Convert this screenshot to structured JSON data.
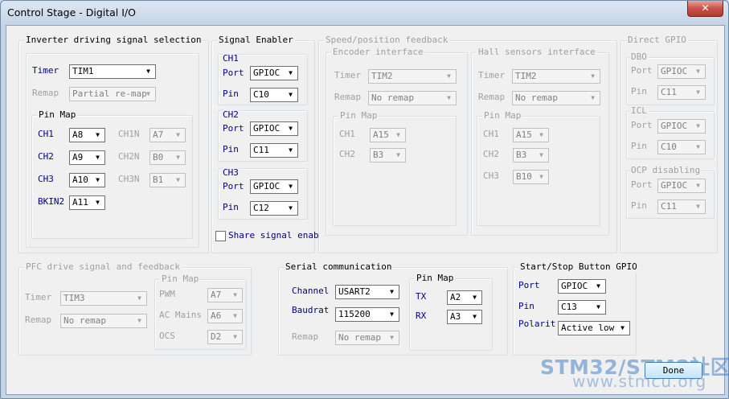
{
  "window": {
    "title": "Control Stage - Digital I/O",
    "close_glyph": "✕"
  },
  "inverter": {
    "legend": "Inverter driving signal selection",
    "timer_label": "Timer",
    "timer_value": "TIM1",
    "remap_label": "Remap",
    "remap_value": "Partial re-map",
    "pinmap": {
      "legend": "Pin Map",
      "ch1_label": "CH1",
      "ch1_value": "A8",
      "ch1n_label": "CH1N",
      "ch1n_value": "A7",
      "ch2_label": "CH2",
      "ch2_value": "A9",
      "ch2n_label": "CH2N",
      "ch2n_value": "B0",
      "ch3_label": "CH3",
      "ch3_value": "A10",
      "ch3n_label": "CH3N",
      "ch3n_value": "B1",
      "bkin2_label": "BKIN2",
      "bkin2_value": "A11"
    }
  },
  "signal_enabler": {
    "legend": "Signal Enabler",
    "ch1": {
      "legend": "CH1",
      "port_label": "Port",
      "port_value": "GPIOC",
      "pin_label": "Pin",
      "pin_value": "C10"
    },
    "ch2": {
      "legend": "CH2",
      "port_label": "Port",
      "port_value": "GPIOC",
      "pin_label": "Pin",
      "pin_value": "C11"
    },
    "ch3": {
      "legend": "CH3",
      "port_label": "Port",
      "port_value": "GPIOC",
      "pin_label": "Pin",
      "pin_value": "C12"
    },
    "share_label": "Share signal enab"
  },
  "speed_feedback": {
    "legend": "Speed/position feedback",
    "encoder": {
      "legend": "Encoder interface",
      "timer_label": "Timer",
      "timer_value": "TIM2",
      "remap_label": "Remap",
      "remap_value": "No remap",
      "pinmap_legend": "Pin Map",
      "ch1_label": "CH1",
      "ch1_value": "A15",
      "ch2_label": "CH2",
      "ch2_value": "B3"
    },
    "hall": {
      "legend": "Hall sensors interface",
      "timer_label": "Timer",
      "timer_value": "TIM2",
      "remap_label": "Remap",
      "remap_value": "No remap",
      "pinmap_legend": "Pin Map",
      "ch1_label": "CH1",
      "ch1_value": "A15",
      "ch2_label": "CH2",
      "ch2_value": "B3",
      "ch3_label": "CH3",
      "ch3_value": "B10"
    }
  },
  "direct_gpio": {
    "legend": "Direct GPIO",
    "dbo": {
      "legend": "DBO",
      "port_label": "Port",
      "port_value": "GPIOC",
      "pin_label": "Pin",
      "pin_value": "C11"
    },
    "icl": {
      "legend": "ICL",
      "port_label": "Port",
      "port_value": "GPIOC",
      "pin_label": "Pin",
      "pin_value": "C10"
    },
    "ocp": {
      "legend": "OCP disabling",
      "port_label": "Port",
      "port_value": "GPIOC",
      "pin_label": "Pin",
      "pin_value": "C11"
    }
  },
  "pfc": {
    "legend": "PFC drive signal and feedback",
    "timer_label": "Timer",
    "timer_value": "TIM3",
    "remap_label": "Remap",
    "remap_value": "No remap",
    "pinmap": {
      "legend": "Pin Map",
      "pwm_label": "PWM",
      "pwm_value": "A7",
      "acmains_label": "AC Mains",
      "acmains_value": "A6",
      "ocs_label": "OCS",
      "ocs_value": "D2"
    }
  },
  "serial": {
    "legend": "Serial communication",
    "channel_label": "Channel",
    "channel_value": "USART2",
    "baudrate_label": "Baudrat",
    "baudrate_value": "115200",
    "remap_label": "Remap",
    "remap_value": "No remap",
    "pinmap": {
      "legend": "Pin Map",
      "tx_label": "TX",
      "tx_value": "A2",
      "rx_label": "RX",
      "rx_value": "A3"
    }
  },
  "startstop": {
    "legend": "Start/Stop Button GPIO",
    "port_label": "Port",
    "port_value": "GPIOC",
    "pin_label": "Pin",
    "pin_value": "C13",
    "polarity_label": "Polarit",
    "polarity_value": "Active low"
  },
  "done_label": "Done",
  "watermark": {
    "line1": "STM32/STM8社区",
    "line2": "www.stmcu.org"
  },
  "colors": {
    "label_blue": "#000080",
    "disabled_gray": "#a0a0a0",
    "accent": "#3c7fb1"
  }
}
